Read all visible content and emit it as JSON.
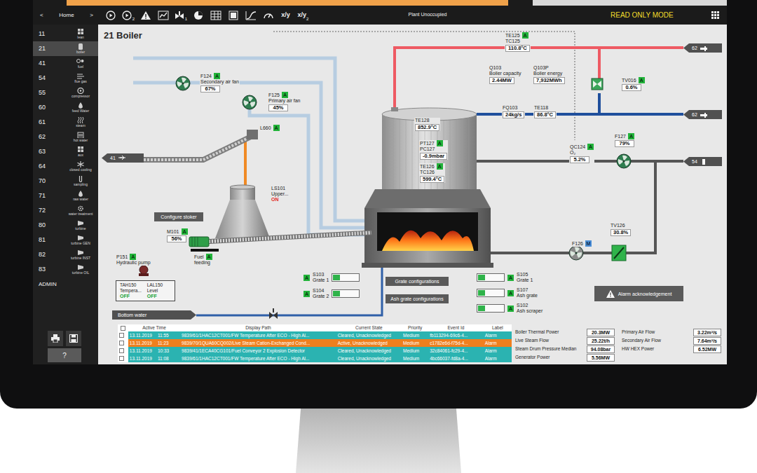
{
  "toolbar": {
    "nav": [
      {
        "label": "<"
      },
      {
        "label": "Home"
      },
      {
        "label": ">"
      }
    ],
    "tools": [
      {
        "kind": "play"
      },
      {
        "kind": "play",
        "sub": "2"
      },
      {
        "kind": "alarm"
      },
      {
        "kind": "trend"
      },
      {
        "kind": "valve",
        "sub": "1"
      },
      {
        "kind": "wrench"
      },
      {
        "kind": "table"
      },
      {
        "kind": "report"
      },
      {
        "kind": "curve"
      },
      {
        "kind": "gauge"
      },
      {
        "kind": "text",
        "label": "x/y"
      },
      {
        "kind": "text",
        "label": "x/y",
        "sub": "2"
      }
    ],
    "status": "Plant Unoccupied",
    "mode": "READ ONLY MODE"
  },
  "sidebar": {
    "items": [
      {
        "number": "11",
        "label": "lean",
        "selected": false
      },
      {
        "number": "21",
        "label": "boiler",
        "selected": true
      },
      {
        "number": "41",
        "label": "fuel",
        "selected": false
      },
      {
        "number": "54",
        "label": "flue gas",
        "selected": false
      },
      {
        "number": "55",
        "label": "compressor",
        "selected": false
      },
      {
        "number": "60",
        "label": "feed Water",
        "selected": false
      },
      {
        "number": "61",
        "label": "steam",
        "selected": false
      },
      {
        "number": "62",
        "label": "hot water",
        "selected": false
      },
      {
        "number": "63",
        "label": "aux",
        "selected": false
      },
      {
        "number": "64",
        "label": "closed cooling",
        "selected": false
      },
      {
        "number": "70",
        "label": "sampling",
        "selected": false
      },
      {
        "number": "71",
        "label": "raw water",
        "selected": false
      },
      {
        "number": "72",
        "label": "water treatment",
        "selected": false
      },
      {
        "number": "80",
        "label": "turbine",
        "selected": false
      },
      {
        "number": "81",
        "label": "turbine GEN",
        "selected": false
      },
      {
        "number": "82",
        "label": "turbine INST",
        "selected": false
      },
      {
        "number": "83",
        "label": "turbine OIL",
        "selected": false
      }
    ],
    "admin": "ADMIN",
    "help": "?"
  },
  "page": {
    "title": "21 Boiler"
  },
  "diagram": {
    "nodes": [
      {
        "lines": [
          "F124",
          "Secondary air fan"
        ],
        "values": [
          "67%"
        ],
        "mode": "A",
        "mode_color": "#22b33a"
      },
      {
        "lines": [
          "F125",
          "Primary air fan"
        ],
        "values": [
          "45%"
        ],
        "mode": "A",
        "mode_color": "#22b33a"
      },
      {
        "lines": [
          "L660"
        ],
        "mode": "A",
        "mode_color": "#22b33a"
      },
      {
        "lines": [
          "LS101",
          "Upper..."
        ],
        "status": "ON",
        "status_color": "#e3261c"
      },
      {
        "lines": [
          "M101"
        ],
        "values": [
          "56%"
        ],
        "mode": "A",
        "mode_color": "#22b33a"
      },
      {
        "lines": [
          "Fuel",
          "feeding"
        ],
        "mode": "A",
        "mode_color": "#22b33a"
      },
      {
        "lines": [
          "P151",
          "Hydraulic pump"
        ],
        "mode": "A",
        "mode_color": "#22b33a"
      },
      {
        "lines": [
          "TE128"
        ],
        "values": [
          "852.9°C"
        ]
      },
      {
        "lines": [
          "PT127",
          "PC127"
        ],
        "values": [
          "-0.9mbar"
        ],
        "mode": "A",
        "mode_color": "#22b33a"
      },
      {
        "lines": [
          "TE126",
          "TC126"
        ],
        "values": [
          "599.4°C"
        ],
        "mode": "A",
        "mode_color": "#22b33a"
      },
      {
        "lines": [
          "TE125",
          "TC125"
        ],
        "values": [
          "110.8°C"
        ],
        "mode": "A",
        "mode_color": "#22b33a"
      },
      {
        "lines": [
          "Q103",
          "Boiler capacity"
        ],
        "values": [
          "2.44MW"
        ]
      },
      {
        "lines": [
          "Q103P",
          "Boiler energy"
        ],
        "values": [
          "7,932MWh"
        ]
      },
      {
        "lines": [
          "TV016"
        ],
        "values": [
          "0.6%"
        ],
        "mode": "A",
        "mode_color": "#22b33a"
      },
      {
        "lines": [
          "FQ103"
        ],
        "values": [
          "24kg/s"
        ]
      },
      {
        "lines": [
          "TE118"
        ],
        "values": [
          "86.8°C"
        ]
      },
      {
        "lines": [
          "QC124",
          "O₂"
        ],
        "values": [
          "5.2%"
        ],
        "mode": "A",
        "mode_color": "#22b33a"
      },
      {
        "lines": [
          "F127"
        ],
        "values": [
          "79%"
        ],
        "mode": "A",
        "mode_color": "#22b33a"
      },
      {
        "lines": [
          "F126"
        ],
        "mode": "M",
        "mode_color": "#4b8fd6"
      },
      {
        "lines": [
          "TV126"
        ],
        "values": [
          "30.8%"
        ]
      }
    ],
    "switches": [
      {
        "tag": "S103",
        "desc": "Grate 1",
        "mode": "A",
        "on": true
      },
      {
        "tag": "S104",
        "desc": "Grate 2",
        "mode": "A",
        "on": true
      },
      {
        "tag": "S105",
        "desc": "Grate 1",
        "mode": "A",
        "on": true
      },
      {
        "tag": "S107",
        "desc": "Ash grate",
        "mode": "A",
        "on": true
      },
      {
        "tag": "S102",
        "desc": "Ash scraper",
        "mode": "A",
        "on": true
      }
    ],
    "alarm_box": [
      {
        "tag": "TAH150",
        "desc": "Tempera...",
        "status": "OFF",
        "status_color": "#22a33a"
      },
      {
        "tag": "LAL150",
        "desc": "Level",
        "status": "OFF",
        "status_color": "#22a33a"
      }
    ],
    "buttons": [
      {
        "label": "Configure stoker",
        "kind": "plain"
      },
      {
        "label": "Grate configurations",
        "kind": "plain"
      },
      {
        "label": "Ash grate configurations",
        "kind": "plain"
      },
      {
        "label": "Alarm acknowledgement",
        "kind": "alarm"
      }
    ],
    "ports": [
      {
        "label": "41",
        "kind": "left"
      },
      {
        "label": "62",
        "kind": "left"
      },
      {
        "label": "62",
        "kind": "left"
      },
      {
        "label": "54",
        "kind": "left"
      },
      {
        "label": "Bottom water",
        "kind": "right"
      }
    ]
  },
  "alarms": {
    "all_checked": false,
    "columns": [
      "Active Time",
      "Display Path",
      "Current State",
      "Priority",
      "Event Id",
      "Label"
    ],
    "rows": [
      {
        "date": "13.11.2019",
        "time": "11:55",
        "path": "9839/61/1HAC12CT001/FW Temperature After ECO - High Al...",
        "state": "Cleared, Unacknowledged",
        "priority": "Medium",
        "event_id": "fb113294-69c6-4...",
        "label": "Alarm",
        "color": "#2bb3b1",
        "checked": false
      },
      {
        "date": "13.11.2019",
        "time": "11:23",
        "path": "9839/70/1QUA60CQ002/Live Steam Cation-Exchanged Cond...",
        "state": "Active, Unacknowledged",
        "priority": "Medium",
        "event_id": "c1782e6d-f75d-4...",
        "label": "Alarm",
        "color": "#f07f1e",
        "checked": false
      },
      {
        "date": "13.11.2019",
        "time": "10:33",
        "path": "9839/41/1ECA40CG101/Fuel Conveyor 2 Explosion Detector",
        "state": "Cleared, Unacknowledged",
        "priority": "Medium",
        "event_id": "32c84061-fc29-4...",
        "label": "Alarm",
        "color": "#2bb3b1",
        "checked": false
      },
      {
        "date": "13.11.2019",
        "time": "11:08",
        "path": "9839/61/1HAC12CT001/FW Temperature After ECO - High Al...",
        "state": "Cleared, Unacknowledged",
        "priority": "Medium",
        "event_id": "4bc66037-fd8a-4...",
        "label": "Alarm",
        "color": "#2bb3b1",
        "checked": false
      }
    ]
  },
  "kpis": [
    {
      "label": "Boiler Thermal Power",
      "value": "20.3MW"
    },
    {
      "label": "Live Steam Flow",
      "value": "25.22t/h"
    },
    {
      "label": "Steam Drum Pressure Median",
      "value": "94.08bar"
    },
    {
      "label": "Generator Power",
      "value": "5.56MW"
    },
    {
      "label": "Primary Air Flow",
      "value": "3.22m³/s"
    },
    {
      "label": "Secondary Air Flow",
      "value": "7.64m³/s"
    },
    {
      "label": "HW HEX Power",
      "value": "6.52MW"
    }
  ]
}
